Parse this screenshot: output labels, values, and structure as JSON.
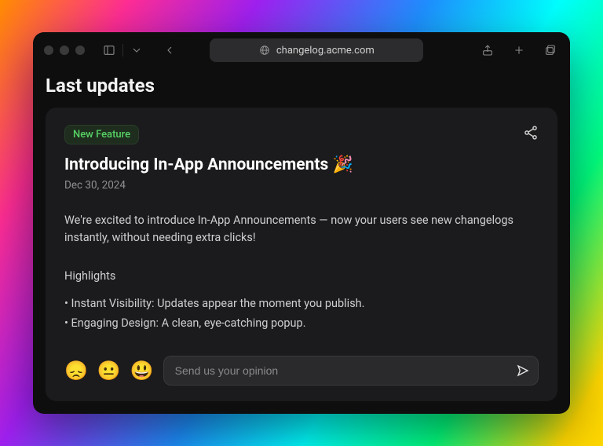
{
  "browser": {
    "url": "changelog.acme.com"
  },
  "page": {
    "heading": "Last updates"
  },
  "post": {
    "badge": "New Feature",
    "title": "Introducing In-App Announcements 🎉",
    "date": "Dec 30, 2024",
    "body": "We're excited to introduce In-App Announcements — now your users see new changelogs instantly, without needing extra clicks!",
    "highlights_label": "Highlights",
    "highlights": [
      "Instant Visibility: Updates appear the moment you publish.",
      "Engaging Design: A clean, eye-catching popup."
    ]
  },
  "feedback": {
    "reactions": [
      "😞",
      "😐",
      "😃"
    ],
    "placeholder": "Send us your opinion"
  }
}
